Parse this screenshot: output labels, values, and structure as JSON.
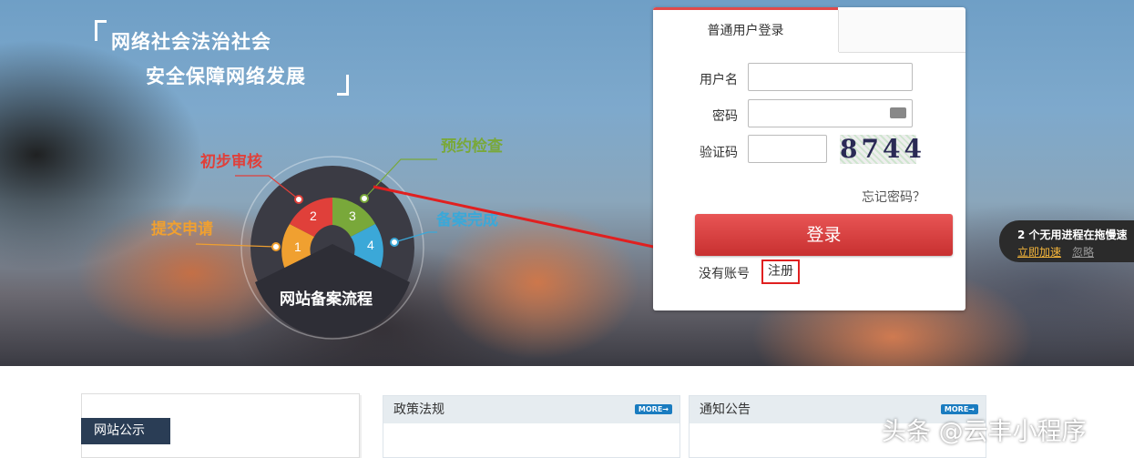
{
  "hero": {
    "slogan_line1": "网络社会法治社会",
    "slogan_line2": "安全保障网络发展",
    "flow": {
      "title": "网站备案流程",
      "steps": [
        {
          "num": "1",
          "label": "提交申请",
          "color": "#f0a030"
        },
        {
          "num": "2",
          "label": "初步审核",
          "color": "#e0403a"
        },
        {
          "num": "3",
          "label": "预约检查",
          "color": "#79a83a"
        },
        {
          "num": "4",
          "label": "备案完成",
          "color": "#3ba8d8"
        }
      ]
    }
  },
  "login": {
    "tab": "普通用户登录",
    "username_label": "用户名",
    "password_label": "密码",
    "captcha_label": "验证码",
    "captcha_code": "8744",
    "forgot": "忘记密码？",
    "button": "登录",
    "no_account": "没有账号",
    "register": "注册"
  },
  "toast": {
    "text": "2 个无用进程在拖慢速",
    "action": "立即加速",
    "ignore": "忽略"
  },
  "bottom": {
    "notice_tab": "网站公示",
    "panels": [
      {
        "title": "政策法规",
        "more": "MORE→"
      },
      {
        "title": "通知公告",
        "more": "MORE→"
      }
    ]
  },
  "watermark": "头条 @云丰小程序",
  "colors": {
    "accent_red": "#d94040",
    "annotation_red": "#e02020"
  }
}
